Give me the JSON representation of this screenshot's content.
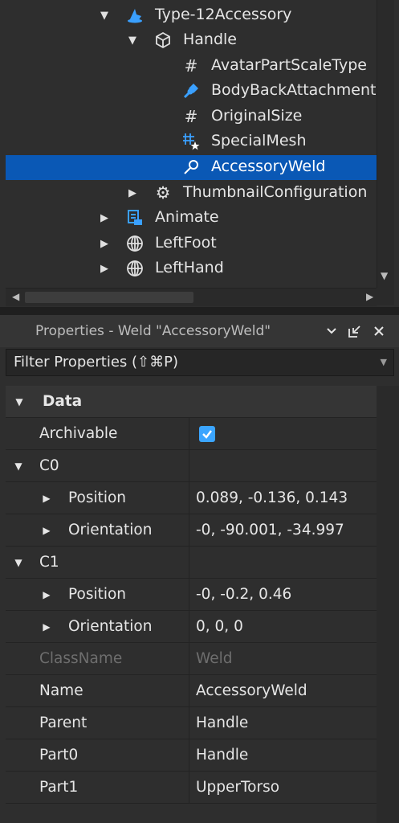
{
  "explorer": {
    "items": [
      {
        "label": "Type-12Accessory",
        "icon": "accessory-icon",
        "toggle": "expanded"
      },
      {
        "label": "Handle",
        "icon": "part-icon",
        "toggle": "expanded"
      },
      {
        "label": "AvatarPartScaleType",
        "icon": "string-value-icon",
        "toggle": "none"
      },
      {
        "label": "BodyBackAttachment",
        "icon": "attachment-icon",
        "toggle": "none"
      },
      {
        "label": "OriginalSize",
        "icon": "value-icon",
        "toggle": "none"
      },
      {
        "label": "SpecialMesh",
        "icon": "special-mesh-icon",
        "toggle": "none"
      },
      {
        "label": "AccessoryWeld",
        "icon": "weld-icon",
        "toggle": "none",
        "selected": true
      },
      {
        "label": "ThumbnailConfiguration",
        "icon": "configuration-icon",
        "toggle": "collapsed"
      },
      {
        "label": "Animate",
        "icon": "local-script-icon",
        "toggle": "collapsed"
      },
      {
        "label": "LeftFoot",
        "icon": "mesh-part-icon",
        "toggle": "collapsed"
      },
      {
        "label": "LeftHand",
        "icon": "mesh-part-icon",
        "toggle": "collapsed"
      }
    ]
  },
  "properties": {
    "title": "Properties - Weld \"AccessoryWeld\"",
    "filter_placeholder": "Filter Properties (⇧⌘P)",
    "category": "Data",
    "rows": [
      {
        "name": "Archivable",
        "type": "checkbox",
        "checked": true
      },
      {
        "name": "C0",
        "type": "group"
      },
      {
        "name": "Position",
        "value": "0.089, -0.136, 0.143",
        "type": "sub"
      },
      {
        "name": "Orientation",
        "value": "-0, -90.001, -34.997",
        "type": "sub"
      },
      {
        "name": "C1",
        "type": "group"
      },
      {
        "name": "Position",
        "value": "-0, -0.2, 0.46",
        "type": "sub"
      },
      {
        "name": "Orientation",
        "value": "0, 0, 0",
        "type": "sub"
      },
      {
        "name": "ClassName",
        "value": "Weld",
        "type": "disabled"
      },
      {
        "name": "Name",
        "value": "AccessoryWeld",
        "type": "plain"
      },
      {
        "name": "Parent",
        "value": "Handle",
        "type": "plain"
      },
      {
        "name": "Part0",
        "value": "Handle",
        "type": "plain"
      },
      {
        "name": "Part1",
        "value": "UpperTorso",
        "type": "plain"
      }
    ]
  },
  "colors": {
    "selection": "#0a58b5",
    "checkbox": "#3ba5ff",
    "panel_bg": "#2e2e2e",
    "header_bg": "#353535"
  }
}
